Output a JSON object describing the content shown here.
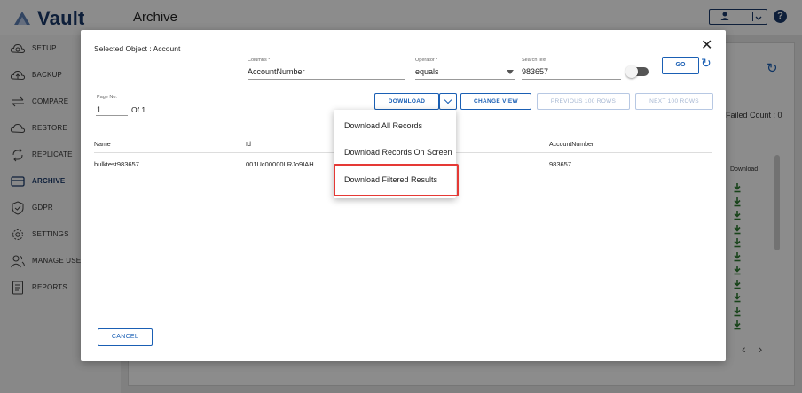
{
  "app": {
    "logo_text": "Vault",
    "page_title": "Archive"
  },
  "sidebar": {
    "items": [
      {
        "label": "SETUP",
        "icon": "gear-cloud-icon"
      },
      {
        "label": "BACKUP",
        "icon": "cloud-upload-icon"
      },
      {
        "label": "COMPARE",
        "icon": "compare-arrows-icon"
      },
      {
        "label": "RESTORE",
        "icon": "cloud-restore-icon"
      },
      {
        "label": "REPLICATE",
        "icon": "replicate-icon"
      },
      {
        "label": "ARCHIVE",
        "icon": "archive-icon"
      },
      {
        "label": "GDPR",
        "icon": "shield-check-icon"
      },
      {
        "label": "SETTINGS",
        "icon": "settings-icon"
      },
      {
        "label": "MANAGE USERS",
        "icon": "users-icon"
      },
      {
        "label": "REPORTS",
        "icon": "report-icon"
      }
    ],
    "active_index": 5
  },
  "background": {
    "failed_count": "Failed Count : 0",
    "download_header": "Download",
    "help_glyph": "?"
  },
  "modal": {
    "selected_object": "Selected Object : Account",
    "columns_label": "Columns *",
    "columns_value": "AccountNumber",
    "operator_label": "Operator *",
    "operator_value": "equals",
    "search_label": "Search text",
    "search_value": "983657",
    "go_label": "GO",
    "page_no_label": "Page No.",
    "page_no_value": "1",
    "of_label": "Of 1",
    "download_label": "DOWNLOAD",
    "change_view_label": "CHANGE VIEW",
    "prev_label": "PREVIOUS 100 ROWS",
    "next_label": "NEXT 100 ROWS",
    "table": {
      "headers": [
        "Name",
        "Id",
        "AccountNumber"
      ],
      "rows": [
        [
          "bulktest983657",
          "001Uc00000LRJo9IAH",
          "983657"
        ]
      ]
    },
    "cancel_label": "CANCEL"
  },
  "download_menu": {
    "items": [
      "Download All Records",
      "Download Records On Screen",
      "Download Filtered Results"
    ],
    "highlighted_index": 2
  },
  "colors": {
    "brand": "#1a3a6b",
    "accent": "#1a5fb4",
    "highlight": "#e53935",
    "download_green": "#2e7d32"
  }
}
